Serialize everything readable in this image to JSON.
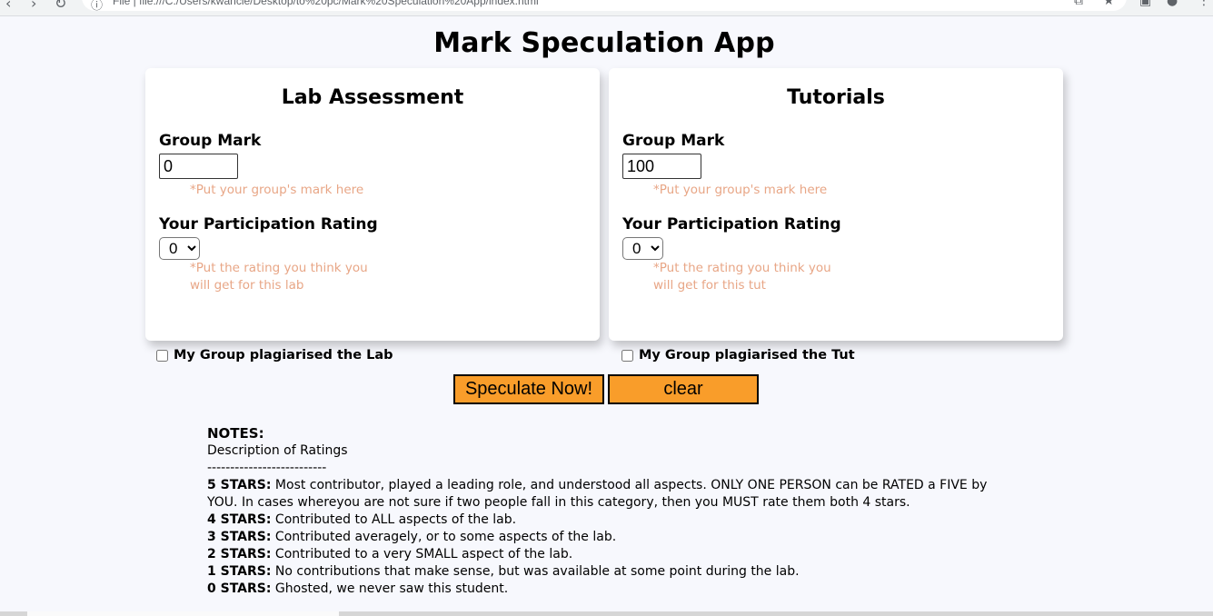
{
  "browser": {
    "url": "File  |  file:///C:/Users/kwancie/Desktop/to%20pc/Mark%20Speculation%20App/index.html"
  },
  "app": {
    "title": "Mark Speculation App"
  },
  "lab": {
    "title": "Lab Assessment",
    "group_mark_label": "Group Mark",
    "group_mark_value": "0",
    "group_mark_hint": "*Put your group's mark here",
    "rating_label": "Your Participation Rating",
    "rating_value": "0",
    "rating_hint_line1": "*Put the rating you think you",
    "rating_hint_line2": "will get for this lab",
    "plagiarised_label": "My Group plagiarised the Lab"
  },
  "tut": {
    "title": "Tutorials",
    "group_mark_label": "Group Mark",
    "group_mark_value": "100",
    "group_mark_hint": "*Put your group's mark here",
    "rating_label": "Your Participation Rating",
    "rating_value": "0",
    "rating_hint_line1": "*Put the rating you think you",
    "rating_hint_line2": "will get for this tut",
    "plagiarised_label": "My Group plagiarised the Tut"
  },
  "buttons": {
    "speculate": "Speculate Now!",
    "clear": "clear"
  },
  "notes": {
    "heading": "NOTES:",
    "subheading": "Description of Ratings",
    "divider": "--------------------------",
    "ratings": [
      {
        "label": "5 STARS:",
        "text": " Most contributor, played a leading role, and understood all aspects. ONLY ONE PERSON can be RATED a FIVE by YOU. In cases whereyou are not sure if two people fall in this category, then you MUST rate them both 4 stars."
      },
      {
        "label": "4 STARS:",
        "text": " Contributed to ALL aspects of the lab."
      },
      {
        "label": "3 STARS:",
        "text": " Contributed averagely, or to some aspects of the lab."
      },
      {
        "label": "2 STARS:",
        "text": " Contributed to a very SMALL aspect of the lab."
      },
      {
        "label": "1 STARS:",
        "text": " No contributions that make sense, but was available at some point during the lab."
      },
      {
        "label": "0 STARS:",
        "text": " Ghosted, we never saw this student."
      }
    ]
  }
}
